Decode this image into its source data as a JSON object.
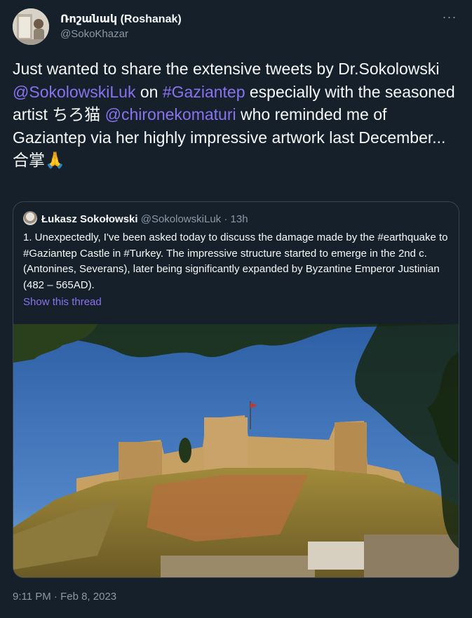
{
  "author": {
    "display_name": "Ռոշանակ (Roshanak)",
    "handle": "@SokoKhazar"
  },
  "tweet": {
    "segments": [
      {
        "text": "Just wanted to share the extensive tweets by Dr.Sokolowski ",
        "type": "text"
      },
      {
        "text": "@SokolowskiLuk",
        "type": "mention"
      },
      {
        "text": " on ",
        "type": "text"
      },
      {
        "text": "#Gaziantep",
        "type": "hashtag"
      },
      {
        "text": " especially with the seasoned artist ちろ猫 ",
        "type": "text"
      },
      {
        "text": "@chironekomaturi",
        "type": "mention"
      },
      {
        "text": " who reminded me of Gaziantep via her highly impressive artwork last December... 合掌🙏",
        "type": "text"
      }
    ],
    "timestamp": "9:11 PM · Feb 8, 2023"
  },
  "quoted": {
    "display_name": "Łukasz Sokołowski",
    "handle": "@SokolowskiLuk",
    "separator": " · ",
    "age": "13h",
    "text": "1. Unexpectedly, I've been asked today to discuss the damage made by the #earthquake to #Gaziantep Castle in #Turkey. The impressive structure started to emerge in the 2nd c. (Antonines, Severans), later being significantly expanded by Byzantine Emperor Justinian (482 – 565AD).",
    "show_thread": "Show this thread"
  },
  "icons": {
    "more": "more-horizontal-icon",
    "praying_hands": "praying-hands-emoji"
  },
  "colors": {
    "background": "#15202b",
    "link": "#8a72f0",
    "secondary_text": "#8b98a5",
    "border": "#38444d"
  }
}
